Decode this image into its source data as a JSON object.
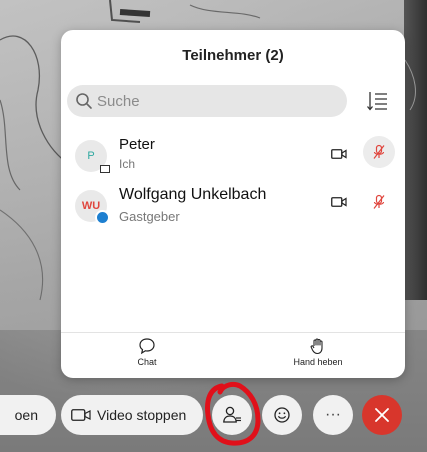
{
  "panel": {
    "title": "Teilnehmer (2)",
    "search_placeholder": "Suche",
    "participants": [
      {
        "initials": "P",
        "name": "Peter",
        "role": "Ich",
        "avatar_color": "#2fa8a0"
      },
      {
        "initials": "WU",
        "name": "Wolfgang Unkelbach",
        "role": "Gastgeber",
        "avatar_color": "#e0463e"
      }
    ],
    "bottom": {
      "chat_label": "Chat",
      "hand_label": "Hand heben"
    }
  },
  "controls": {
    "left_partial_label": "oen",
    "video_label": "Video stoppen",
    "more_label": "···"
  },
  "colors": {
    "muted_mic": "#e0463e",
    "leave_button": "#d8362c",
    "annotation": "#e0101a",
    "host_badge": "#1d7fd0"
  },
  "icons": [
    "search-icon",
    "sort-icon",
    "camera-icon",
    "mic-muted-icon",
    "chat-icon",
    "hand-icon",
    "participants-icon",
    "reaction-icon",
    "more-icon",
    "close-icon"
  ]
}
